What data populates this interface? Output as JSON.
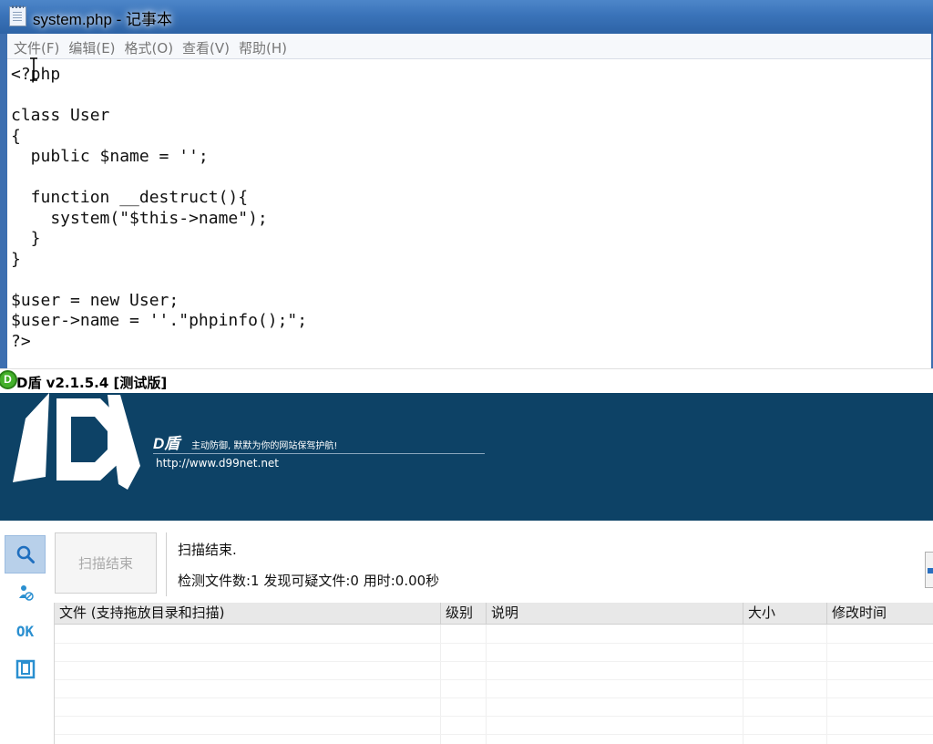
{
  "notepad": {
    "title": "system.php - 记事本",
    "menu": [
      "文件(F)",
      "编辑(E)",
      "格式(O)",
      "查看(V)",
      "帮助(H)"
    ],
    "code": "<?php\n\nclass User\n{\n  public $name = '';\n\n  function __destruct(){\n    system(\"$this->name\");\n  }\n}\n\n$user = new User;\n$user->name = ''.\"phpinfo();\";\n?>"
  },
  "dshield": {
    "title": "D盾 v2.1.5.4 [测试版]",
    "app_icon_letter": "D",
    "banner": {
      "brand": "D盾",
      "slogan": "主动防御, 默默为你的网站保驾护航!",
      "url": "http://www.d99net.net"
    },
    "sidebar": {
      "items": [
        {
          "icon": "search-icon",
          "active": true
        },
        {
          "icon": "process-icon",
          "active": false
        },
        {
          "icon": "ok-icon",
          "label": "OK",
          "active": false
        },
        {
          "icon": "window-icon",
          "active": false
        }
      ]
    },
    "scan_button": "扫描结束",
    "status_line1": "扫描结束.",
    "status_line2": "检测文件数:1 发现可疑文件:0 用时:0.00秒",
    "table": {
      "columns": [
        "文件 (支持拖放目录和扫描)",
        "级别",
        "说明",
        "大小",
        "修改时间"
      ],
      "rows": []
    },
    "accent_color": "#0d4266"
  }
}
